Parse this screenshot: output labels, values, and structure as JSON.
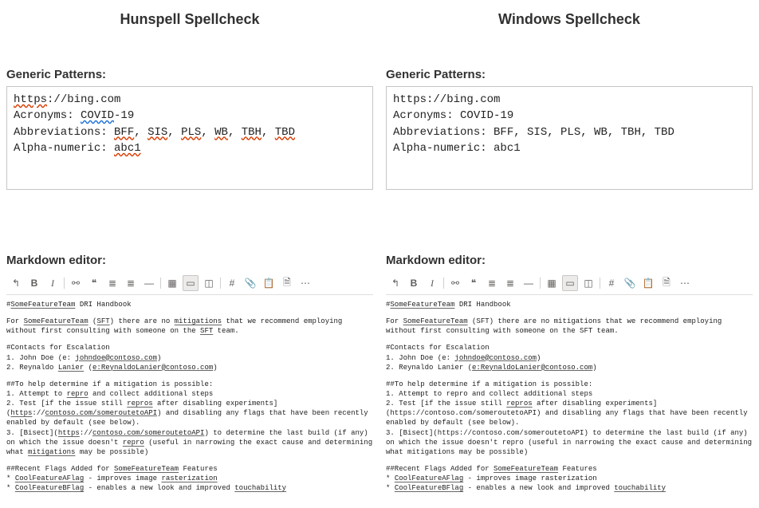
{
  "left": {
    "title": "Hunspell Spellcheck",
    "patterns_label": "Generic Patterns:",
    "url_proto": "https",
    "url_rest": "://bing.com",
    "acronyms_label": "Acronyms: ",
    "acronyms_value": "COVID",
    "acronyms_suffix": "-19",
    "abbr_label": "Abbreviations: ",
    "abbr_items": [
      "BFF",
      "SIS",
      "PLS",
      "WB",
      "TBH",
      "TBD"
    ],
    "alnum_label": "Alpha-numeric: ",
    "alnum_value": "abc1",
    "md_label": "Markdown editor:",
    "md": {
      "l1_a": "#",
      "l1_b": "SomeFeatureTeam",
      "l1_c": " DRI Handbook",
      "l2_a": "For ",
      "l2_b": "SomeFeatureTeam",
      "l2_c": " (",
      "l2_d": "SFT",
      "l2_e": ") there are no ",
      "l2_f": "mitigations",
      "l2_g": " that we recommend employing without first consulting with someone on the ",
      "l2_h": "SFT",
      "l2_i": " team.",
      "l3": "#Contacts for Escalation",
      "l4_a": "1. John Doe (e: ",
      "l4_b": "johndoe@contoso.com",
      "l4_c": ")",
      "l5_a": "2. Reynaldo ",
      "l5_b": "Lanier",
      "l5_c": " (",
      "l5_d": "e:ReynaldoLanier@contoso.com",
      "l5_e": ")",
      "l6": "##To help determine if a mitigation is possible:",
      "l7_a": "1. Attempt to ",
      "l7_b": "repro",
      "l7_c": " and collect additional steps",
      "l8_a": "2. Test [if the issue still ",
      "l8_b": "repros",
      "l8_c": " after disabling experiments](",
      "l8_d": "https",
      "l8_e": "://",
      "l8_f": "contoso.com/someroutetoAPI",
      "l8_g": ") and disabling any flags that have been recently enabled by default (see below).",
      "l9_a": "3. [Bisect](",
      "l9_b": "https",
      "l9_c": "://",
      "l9_d": "contoso.com/someroutetoAPI",
      "l9_e": ") to determine the last build (if any) on which the issue doesn't ",
      "l9_f": "repro",
      "l9_g": " (useful in narrowing the exact cause and determining what ",
      "l9_h": "mitigations",
      "l9_i": " may be possible)",
      "l10_a": "##Recent Flags Added for ",
      "l10_b": "SomeFeatureTeam",
      "l10_c": " Features",
      "l11_a": "* ",
      "l11_b": "CoolFeatureAFlag",
      "l11_c": " - improves image ",
      "l11_d": "rasterization",
      "l12_a": "* ",
      "l12_b": "CoolFeatureBFlag",
      "l12_c": " - enables a new look and improved ",
      "l12_d": "touchability"
    }
  },
  "right": {
    "title": "Windows Spellcheck",
    "patterns_label": "Generic Patterns:",
    "url_full": "https://bing.com",
    "acronyms_line": "Acronyms: COVID-19",
    "abbr_line": "Abbreviations: BFF, SIS, PLS, WB, TBH, TBD",
    "alnum_line": "Alpha-numeric: abc1",
    "md_label": "Markdown editor:",
    "md": {
      "l1_a": "#",
      "l1_b": "SomeFeatureTeam",
      "l1_c": " DRI Handbook",
      "l2_a": "For ",
      "l2_b": "SomeFeatureTeam",
      "l2_c": " (SFT) there are no mitigations that we recommend employing without first consulting with someone on the SFT team.",
      "l3": "#Contacts for Escalation",
      "l4_a": "1. John Doe (e: ",
      "l4_b": "johndoe@contoso.com",
      "l4_c": ")",
      "l5_a": "2. Reynaldo Lanier (",
      "l5_b": "e:ReynaldoLanier@contoso.com",
      "l5_c": ")",
      "l6": "##To help determine if a mitigation is possible:",
      "l7": "1. Attempt to repro and collect additional steps",
      "l8_a": "2. Test [if the issue still ",
      "l8_b": "repros",
      "l8_c": " after disabling experiments](https://contoso.com/someroutetoAPI) and disabling any flags that have been recently enabled by default (see below).",
      "l9": "3. [Bisect](https://contoso.com/someroutetoAPI) to determine the last build (if any) on which the issue doesn't repro (useful in narrowing the exact cause and determining what mitigations may be possible)",
      "l10_a": "##Recent Flags Added for ",
      "l10_b": "SomeFeatureTeam",
      "l10_c": " Features",
      "l11_a": "* ",
      "l11_b": "CoolFeatureAFlag",
      "l11_c": " - improves image rasterization",
      "l12_a": "* ",
      "l12_b": "CoolFeatureBFlag",
      "l12_c": " - enables a new look and improved ",
      "l12_d": "touchability"
    }
  },
  "toolbar": {
    "undo": "↰",
    "bold": "B",
    "italic": "I",
    "link": "⚯",
    "quote": "❝",
    "ul": "≣",
    "ol": "≣",
    "hr": "—",
    "table": "▦",
    "view": "▭",
    "split": "◫",
    "hash": "#",
    "clip": "📎",
    "paste": "📋",
    "save": "🗎",
    "more": "⋯"
  }
}
